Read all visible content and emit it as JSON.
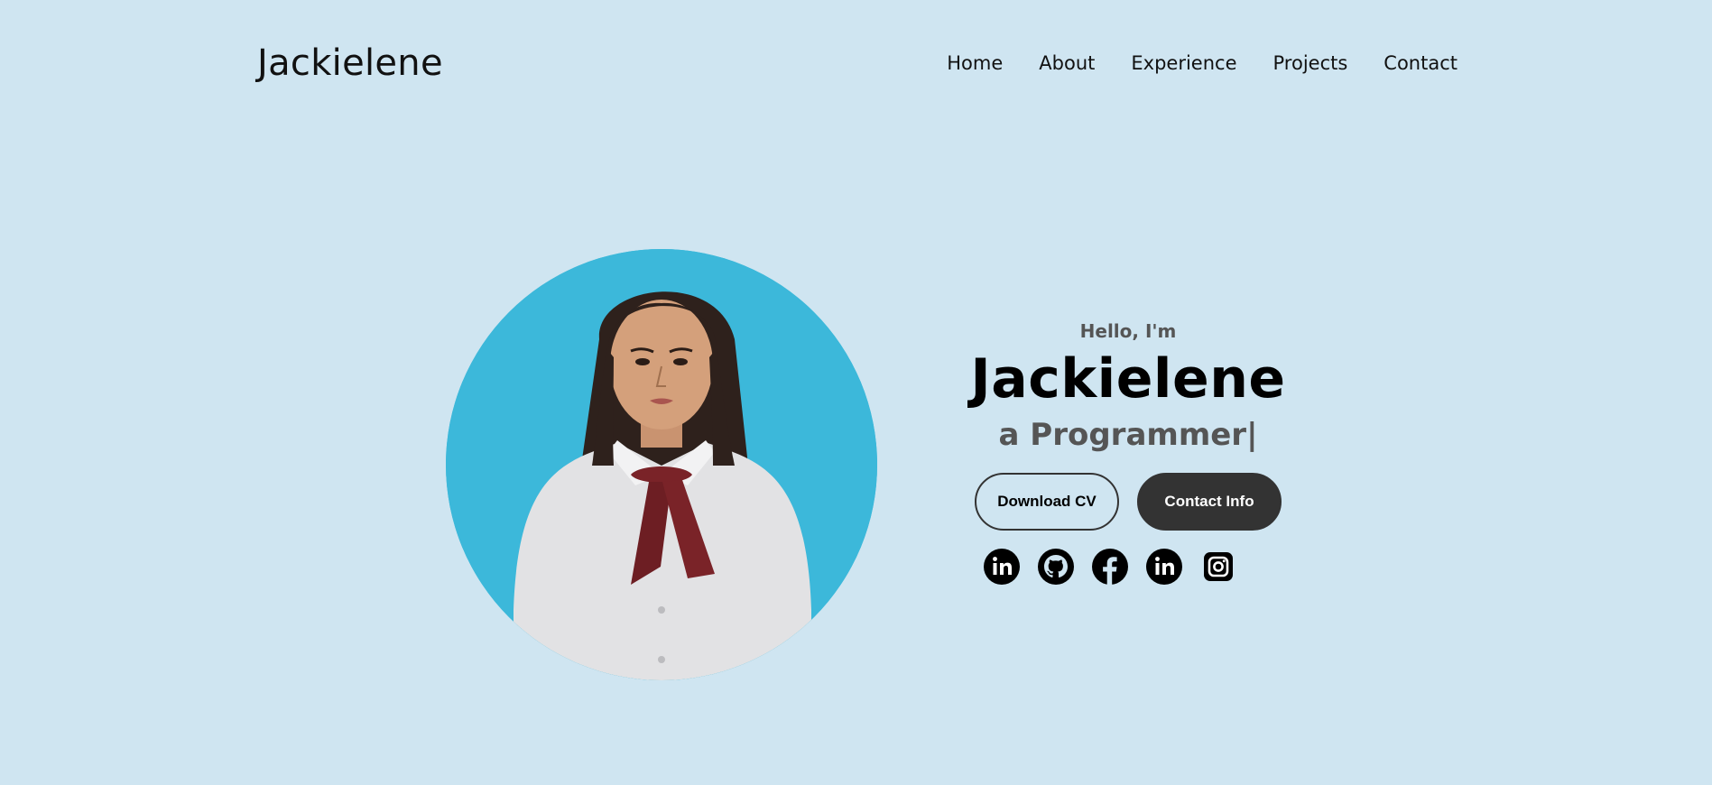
{
  "header": {
    "logo": "Jackielene",
    "nav": [
      "Home",
      "About",
      "Experience",
      "Projects",
      "Contact"
    ]
  },
  "hero": {
    "greeting": "Hello, I'm",
    "name": "Jackielene",
    "role_prefix": "a",
    "role": "Programmer",
    "cursor": "|",
    "buttons": {
      "download": "Download CV",
      "contact": "Contact Info"
    },
    "socials": [
      "linkedin-icon",
      "github-icon",
      "facebook-icon",
      "linkedin-icon",
      "instagram-icon"
    ]
  },
  "colors": {
    "page_bg": "#cfe5f1",
    "photo_bg": "#3cb8da",
    "button_dark": "#333333",
    "muted_text": "#555555"
  }
}
